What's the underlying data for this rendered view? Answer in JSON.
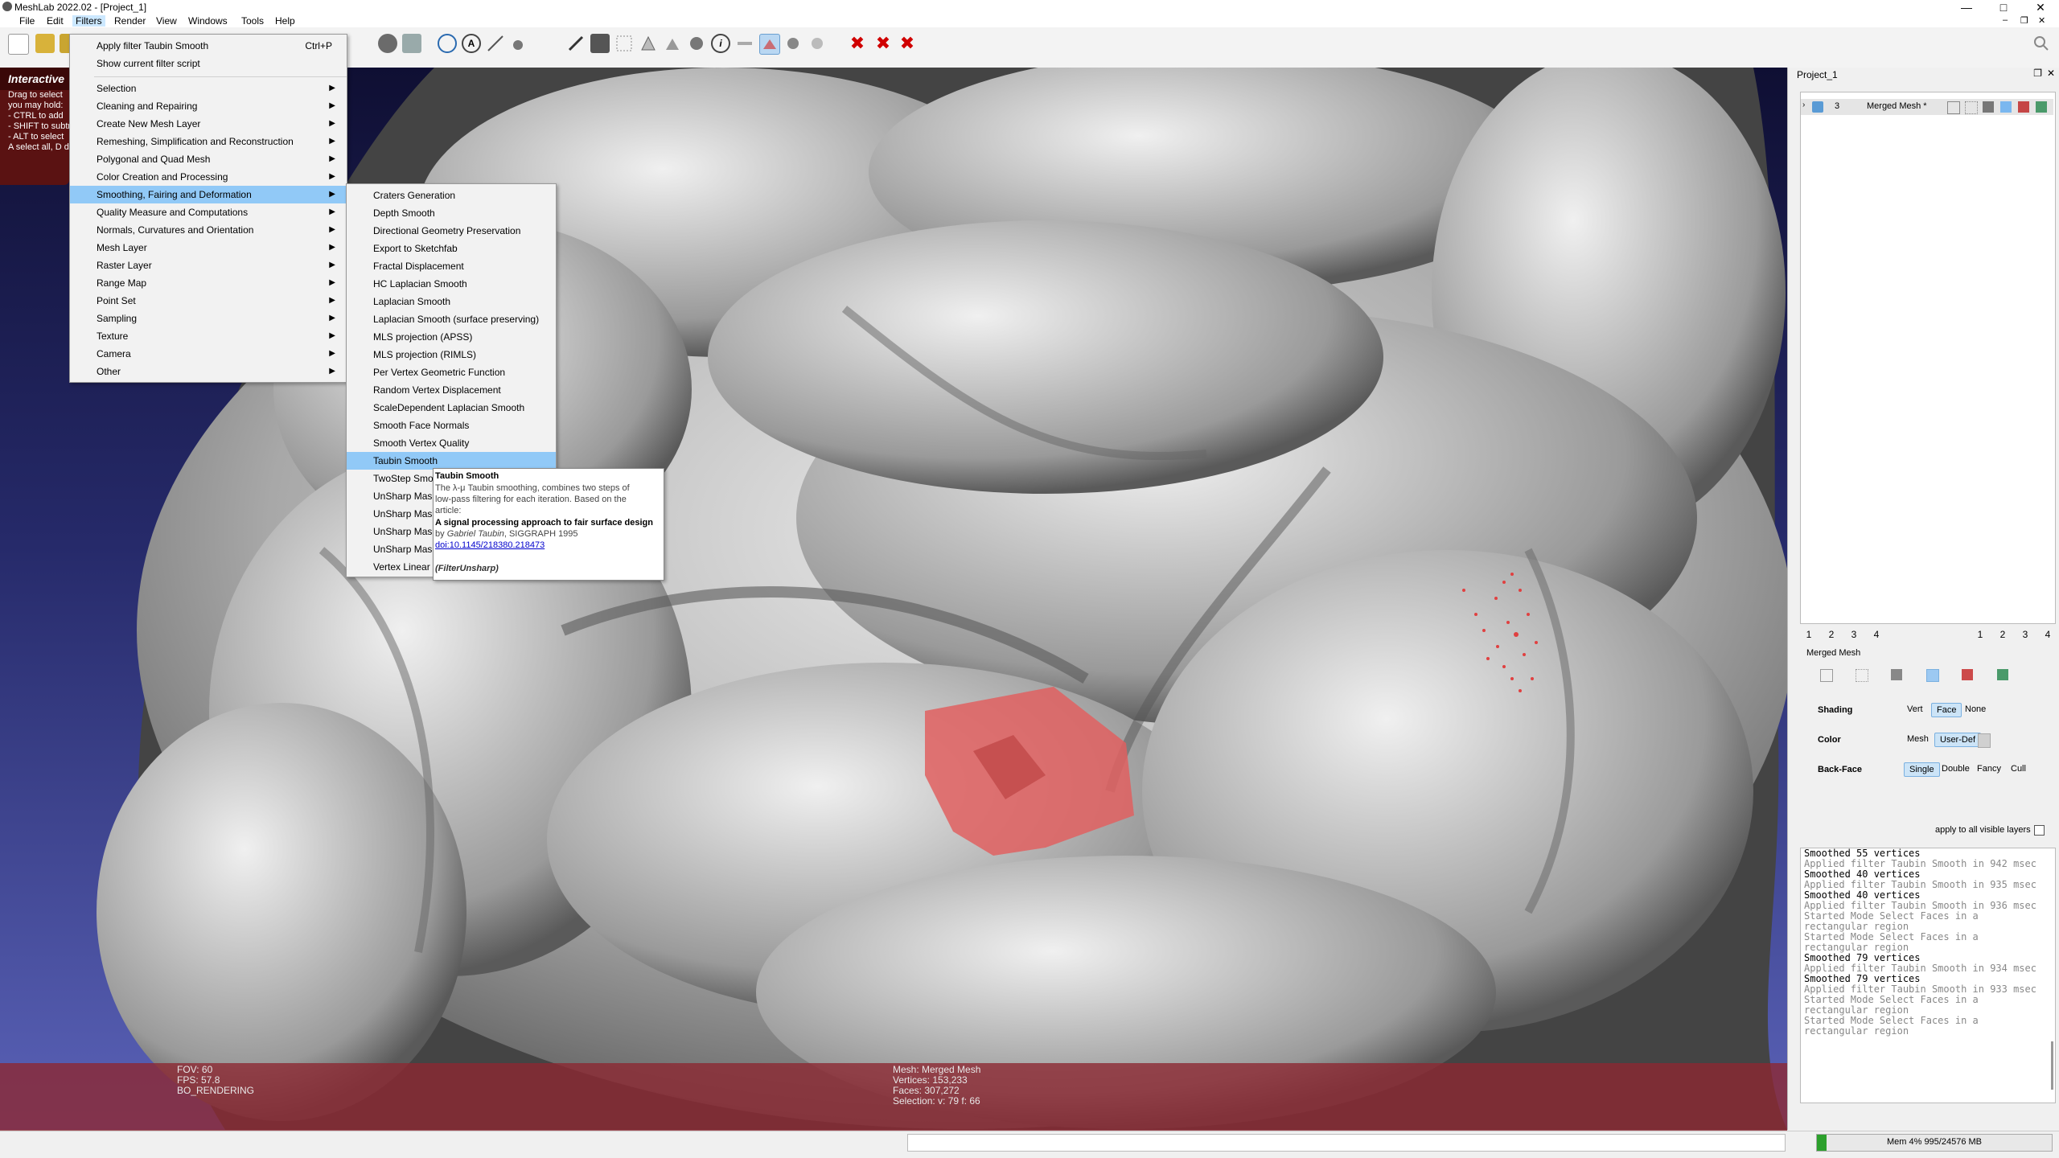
{
  "window": {
    "title": "MeshLab 2022.02 - [Project_1]",
    "controls": [
      "—",
      "□",
      "✕"
    ],
    "inner_controls": [
      "–",
      "❐",
      "✕"
    ]
  },
  "menubar": {
    "items": [
      "File",
      "Edit",
      "Filters",
      "Render",
      "View",
      "Windows",
      "Tools",
      "Help"
    ],
    "active": "Filters"
  },
  "hint": {
    "title": "Interactive",
    "lines": [
      "Drag to select",
      "",
      "you may hold:",
      "- CTRL to add",
      "- SHIFT to subtr",
      "- ALT to select",
      "",
      "A select all, D d"
    ]
  },
  "filters_menu": {
    "apply_label": "Apply filter Taubin Smooth",
    "apply_shortcut": "Ctrl+P",
    "show_script": "Show current filter script",
    "categories": [
      "Selection",
      "Cleaning and Repairing",
      "Create New Mesh Layer",
      "Remeshing, Simplification and Reconstruction",
      "Polygonal and Quad Mesh",
      "Color Creation and Processing",
      "Smoothing, Fairing and Deformation",
      "Quality Measure and Computations",
      "Normals, Curvatures and Orientation",
      "Mesh Layer",
      "Raster Layer",
      "Range Map",
      "Point Set",
      "Sampling",
      "Texture",
      "Camera",
      "Other"
    ],
    "highlighted": "Smoothing, Fairing and Deformation"
  },
  "smoothing_submenu": {
    "items": [
      "Craters Generation",
      "Depth Smooth",
      "Directional Geometry Preservation",
      "Export to Sketchfab",
      "Fractal Displacement",
      "HC Laplacian Smooth",
      "Laplacian Smooth",
      "Laplacian Smooth (surface preserving)",
      "MLS projection (APSS)",
      "MLS projection (RIMLS)",
      "Per Vertex Geometric Function",
      "Random Vertex Displacement",
      "ScaleDependent Laplacian Smooth",
      "Smooth Face Normals",
      "Smooth Vertex Quality",
      "Taubin Smooth",
      "TwoStep Smo",
      "UnSharp Mas",
      "UnSharp Mas",
      "UnSharp Mas",
      "UnSharp Mas",
      "Vertex Linear"
    ],
    "highlighted": "Taubin Smooth"
  },
  "tooltip": {
    "title": "Taubin Smooth",
    "desc1": "The λ-μ Taubin smoothing, combines two steps of",
    "desc2": "low-pass filtering for each iteration. Based on the",
    "desc3": "article:",
    "paper": "A signal processing approach to fair surface design",
    "by_prefix": "by ",
    "author": "Gabriel Taubin",
    "venue": ", SIGGRAPH 1995",
    "doi": "doi:10.1145/218380.218473",
    "plugin": "(FilterUnsharp)"
  },
  "viewport_info": {
    "left": [
      "FOV: 60",
      "FPS:    57.8",
      "BO_RENDERING"
    ],
    "right": [
      "Mesh: Merged Mesh",
      "Vertices: 153,233",
      "Faces: 307,272",
      "Selection: v: 79 f: 66"
    ]
  },
  "right_panel": {
    "project_title": "Project_1",
    "layer": {
      "number": "3",
      "name": "Merged Mesh *"
    },
    "view_buttons_left": [
      "1",
      "2",
      "3",
      "4"
    ],
    "view_buttons_right": [
      "1",
      "2",
      "3",
      "4"
    ],
    "mesh_label": "Merged Mesh",
    "shading": {
      "label": "Shading",
      "options": [
        "Vert",
        "Face",
        "None"
      ],
      "selected": "Face"
    },
    "color": {
      "label": "Color",
      "options": [
        "Mesh",
        "User-Def"
      ],
      "selected": "User-Def"
    },
    "backface": {
      "label": "Back-Face",
      "options": [
        "Single",
        "Double",
        "Fancy",
        "Cull"
      ],
      "selected": "Single"
    },
    "apply_all_label": "apply to all visible layers",
    "log": [
      {
        "text": "Smoothed 55 vertices",
        "style": "strong"
      },
      {
        "text": "Applied filter Taubin Smooth in 942 msec",
        "style": "dim"
      },
      {
        "text": "Smoothed 40 vertices",
        "style": "strong"
      },
      {
        "text": "Applied filter Taubin Smooth in 935 msec",
        "style": "dim"
      },
      {
        "text": "Smoothed 40 vertices",
        "style": "strong"
      },
      {
        "text": "Applied filter Taubin Smooth in 936 msec",
        "style": "dim"
      },
      {
        "text": "Started Mode Select Faces in a rectangular region",
        "style": "dim"
      },
      {
        "text": "Started Mode Select Faces in a rectangular region",
        "style": "dim"
      },
      {
        "text": "Smoothed 79 vertices",
        "style": "strong"
      },
      {
        "text": "Applied filter Taubin Smooth in 934 msec",
        "style": "dim"
      },
      {
        "text": "Smoothed 79 vertices",
        "style": "strong"
      },
      {
        "text": "Applied filter Taubin Smooth in 933 msec",
        "style": "dim"
      },
      {
        "text": "Started Mode Select Faces in a rectangular region",
        "style": "dim"
      },
      {
        "text": "Started Mode Select Faces in a rectangular region",
        "style": "dim"
      }
    ]
  },
  "statusbar": {
    "memory": "Mem 4% 995/24576 MB",
    "memory_fraction": 0.04
  },
  "colors": {
    "selection_red": "#e06060",
    "menu_highlight": "#91c9f7",
    "info_overlay": "#8c2832"
  }
}
